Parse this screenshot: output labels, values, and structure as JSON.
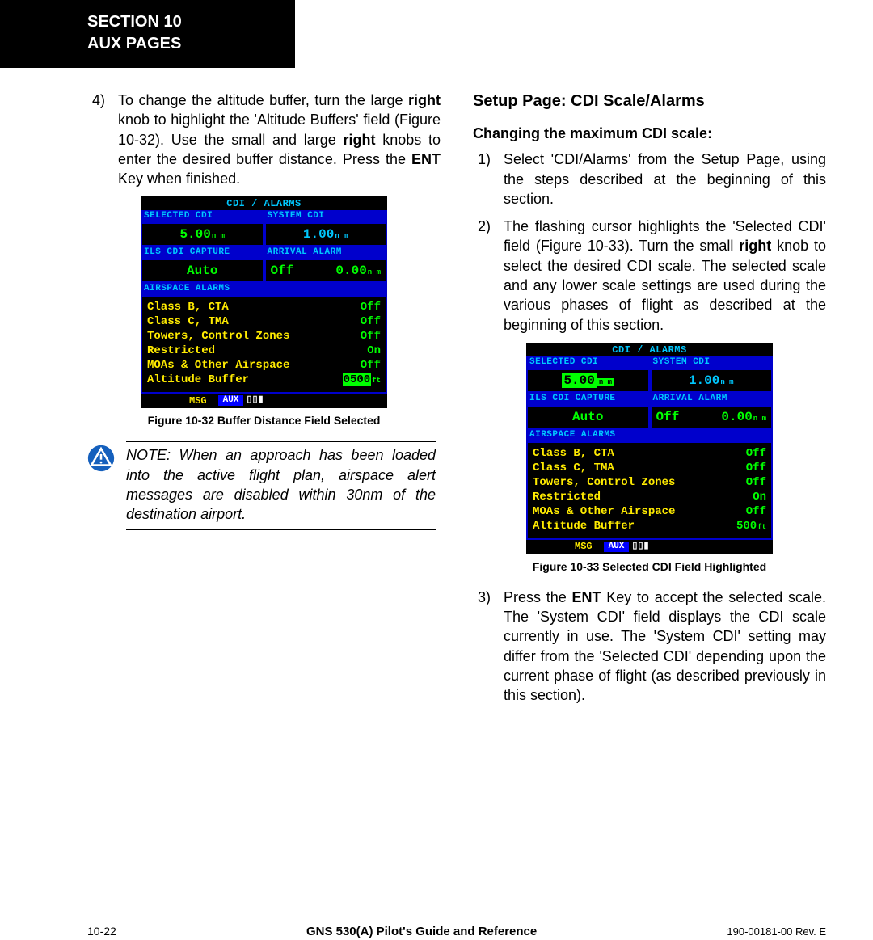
{
  "header": {
    "line1": "SECTION 10",
    "line2": "AUX PAGES"
  },
  "left_col": {
    "step4": {
      "num": "4)",
      "p1a": "To change the altitude buffer, turn the large ",
      "p1b": "right",
      "p1c": " knob to highlight the 'Altitude Buffers' field (Figure 10-32).  Use the small and large ",
      "p1d": "right",
      "p1e": " knobs to enter the desired buffer distance. Press the ",
      "p1f": "ENT",
      "p1g": " Key when finished."
    },
    "fig32": {
      "title": "CDI / ALARMS",
      "sel_cdi_label": "SELECTED CDI",
      "sys_cdi_label": "SYSTEM CDI",
      "sel_cdi_val": "5.00",
      "sys_cdi_val": "1.00",
      "nm_unit": "n m",
      "ils_label": "ILS CDI CAPTURE",
      "arr_label": "ARRIVAL ALARM",
      "ils_val": "Auto",
      "arr_off": "Off",
      "arr_val": "0.00",
      "air_label": "AIRSPACE ALARMS",
      "rows": [
        {
          "name": "Class B, CTA",
          "val": "Off"
        },
        {
          "name": "Class C, TMA",
          "val": "Off"
        },
        {
          "name": "Towers, Control Zones",
          "val": "Off"
        },
        {
          "name": "Restricted",
          "val": "On"
        },
        {
          "name": "MOAs & Other Airspace",
          "val": "Off"
        }
      ],
      "alt_buf_label": "Altitude Buffer",
      "alt_buf_val": "0500",
      "alt_buf_unit": "ft",
      "msg": "MSG",
      "aux": "AUX",
      "dots": "▯▯▮",
      "caption": "Figure 10-32  Buffer Distance Field Selected"
    },
    "note": "NOTE: When an approach has been loaded into the active flight plan, airspace alert messages are disabled within 30nm of the destination airport."
  },
  "right_col": {
    "heading": "Setup Page: CDI Scale/Alarms",
    "subheading": "Changing the maximum CDI scale:",
    "step1": {
      "num": "1)",
      "text": "Select 'CDI/Alarms' from the Setup Page, using the steps described at the beginning of this section."
    },
    "step2": {
      "num": "2)",
      "p1a": "The flashing cursor highlights the 'Selected CDI' field (Figure 10-33).  Turn the small ",
      "p1b": "right",
      "p1c": " knob to select the desired CDI scale.  The selected scale and any lower scale settings are used during the various phases of flight as described at the beginning of this section."
    },
    "fig33": {
      "title": "CDI / ALARMS",
      "sel_cdi_label": "SELECTED CDI",
      "sys_cdi_label": "SYSTEM CDI",
      "sel_cdi_val": "5.00",
      "sys_cdi_val": "1.00",
      "nm_unit": "n m",
      "ils_label": "ILS CDI CAPTURE",
      "arr_label": "ARRIVAL ALARM",
      "ils_val": "Auto",
      "arr_off": "Off",
      "arr_val": "0.00",
      "air_label": "AIRSPACE ALARMS",
      "rows": [
        {
          "name": "Class B, CTA",
          "val": "Off"
        },
        {
          "name": "Class C, TMA",
          "val": "Off"
        },
        {
          "name": "Towers, Control Zones",
          "val": "Off"
        },
        {
          "name": "Restricted",
          "val": "On"
        },
        {
          "name": "MOAs & Other Airspace",
          "val": "Off"
        }
      ],
      "alt_buf_label": "Altitude Buffer",
      "alt_buf_val": "500",
      "alt_buf_unit": "ft",
      "msg": "MSG",
      "aux": "AUX",
      "dots": "▯▯▮",
      "caption": "Figure 10-33  Selected CDI Field Highlighted"
    },
    "step3": {
      "num": "3)",
      "p1a": "Press the ",
      "p1b": "ENT",
      "p1c": " Key to accept the selected scale.  The 'System CDI' field displays the CDI scale currently in use.  The 'System CDI' setting may differ from the 'Selected CDI' depending upon the current phase of flight (as described previously in this section)."
    }
  },
  "footer": {
    "page_num": "10-22",
    "center": "GNS 530(A) Pilot's Guide and Reference",
    "rev": "190-00181-00  Rev. E"
  }
}
